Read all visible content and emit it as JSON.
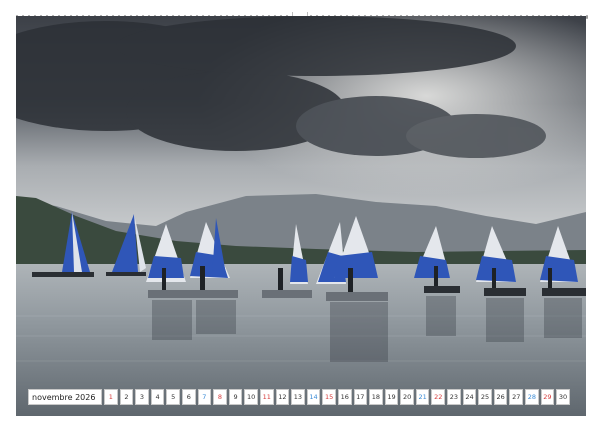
{
  "calendar": {
    "month_label": "novembre",
    "year_label": "2026",
    "days": [
      {
        "n": "1",
        "kind": "sun"
      },
      {
        "n": "2",
        "kind": "wd"
      },
      {
        "n": "3",
        "kind": "wd"
      },
      {
        "n": "4",
        "kind": "wd"
      },
      {
        "n": "5",
        "kind": "wd"
      },
      {
        "n": "6",
        "kind": "wd"
      },
      {
        "n": "7",
        "kind": "sat"
      },
      {
        "n": "8",
        "kind": "sun"
      },
      {
        "n": "9",
        "kind": "wd"
      },
      {
        "n": "10",
        "kind": "wd"
      },
      {
        "n": "11",
        "kind": "sun"
      },
      {
        "n": "12",
        "kind": "wd"
      },
      {
        "n": "13",
        "kind": "wd"
      },
      {
        "n": "14",
        "kind": "sat"
      },
      {
        "n": "15",
        "kind": "sun"
      },
      {
        "n": "16",
        "kind": "wd"
      },
      {
        "n": "17",
        "kind": "wd"
      },
      {
        "n": "18",
        "kind": "wd"
      },
      {
        "n": "19",
        "kind": "wd"
      },
      {
        "n": "20",
        "kind": "wd"
      },
      {
        "n": "21",
        "kind": "sat"
      },
      {
        "n": "22",
        "kind": "sun"
      },
      {
        "n": "23",
        "kind": "wd"
      },
      {
        "n": "24",
        "kind": "wd"
      },
      {
        "n": "25",
        "kind": "wd"
      },
      {
        "n": "26",
        "kind": "wd"
      },
      {
        "n": "27",
        "kind": "wd"
      },
      {
        "n": "28",
        "kind": "sat"
      },
      {
        "n": "29",
        "kind": "sun"
      },
      {
        "n": "30",
        "kind": "wd"
      }
    ]
  },
  "photo": {
    "subject": "sailboats-on-lake",
    "sail_color": "#2f56b8",
    "sky_color": "#4a4f57",
    "water_color": "#7d868e"
  }
}
